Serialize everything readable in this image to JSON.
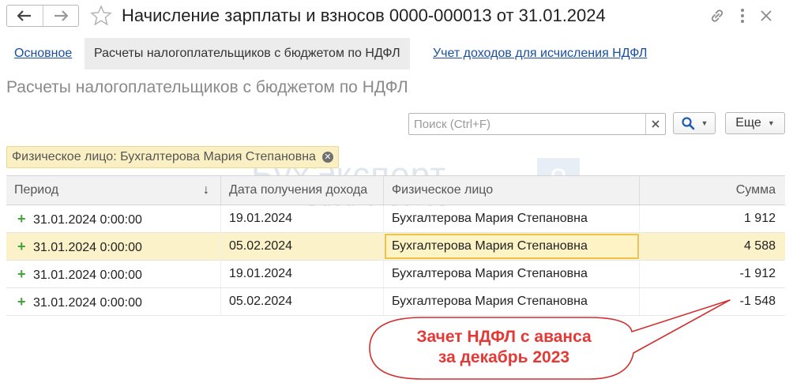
{
  "header": {
    "title": "Начисление зарплаты и взносов 0000-000013 от 31.01.2024",
    "back_icon": "arrow-left-icon",
    "forward_icon": "arrow-right-icon",
    "favorite_icon": "star-icon",
    "link_icon": "link-icon",
    "more_icon": "more-vertical-icon",
    "close_icon": "close-icon"
  },
  "tabs": [
    {
      "label": "Основное"
    },
    {
      "label": "Расчеты налогоплательщиков с бюджетом по НДФЛ"
    },
    {
      "label": "Учет доходов для исчисления НДФЛ"
    }
  ],
  "page_title": "Расчеты налогоплательщиков с бюджетом по НДФЛ",
  "search": {
    "placeholder": "Поиск (Ctrl+F)",
    "value": ""
  },
  "toolbar": {
    "more_label": "Еще"
  },
  "filter": {
    "label": "Физическое лицо: Бухгалтерова Мария Степановна"
  },
  "watermark": {
    "brand": "БухЭксперт",
    "sub": "База ответов",
    "number": "8"
  },
  "table": {
    "columns": [
      "Период",
      "Дата получения дохода",
      "Физическое лицо",
      "Сумма"
    ],
    "sort_indicator": "↓",
    "rows": [
      {
        "period": "31.01.2024 0:00:00",
        "date": "19.01.2024",
        "person": "Бухгалтерова Мария Степановна",
        "sum": "1 912"
      },
      {
        "period": "31.01.2024 0:00:00",
        "date": "05.02.2024",
        "person": "Бухгалтерова Мария Степановна",
        "sum": "4 588"
      },
      {
        "period": "31.01.2024 0:00:00",
        "date": "19.01.2024",
        "person": "Бухгалтерова Мария Степановна",
        "sum": "-1 912"
      },
      {
        "period": "31.01.2024 0:00:00",
        "date": "05.02.2024",
        "person": "Бухгалтерова Мария Степановна",
        "sum": "-1 548"
      }
    ]
  },
  "callout": {
    "line1": "Зачет НДФЛ с аванса",
    "line2": "за декабрь 2023"
  },
  "colors": {
    "accent_link": "#1a4fa0",
    "selected_row": "#fcf2c9",
    "callout_red": "#e53935",
    "plus_green": "#41a33a"
  }
}
